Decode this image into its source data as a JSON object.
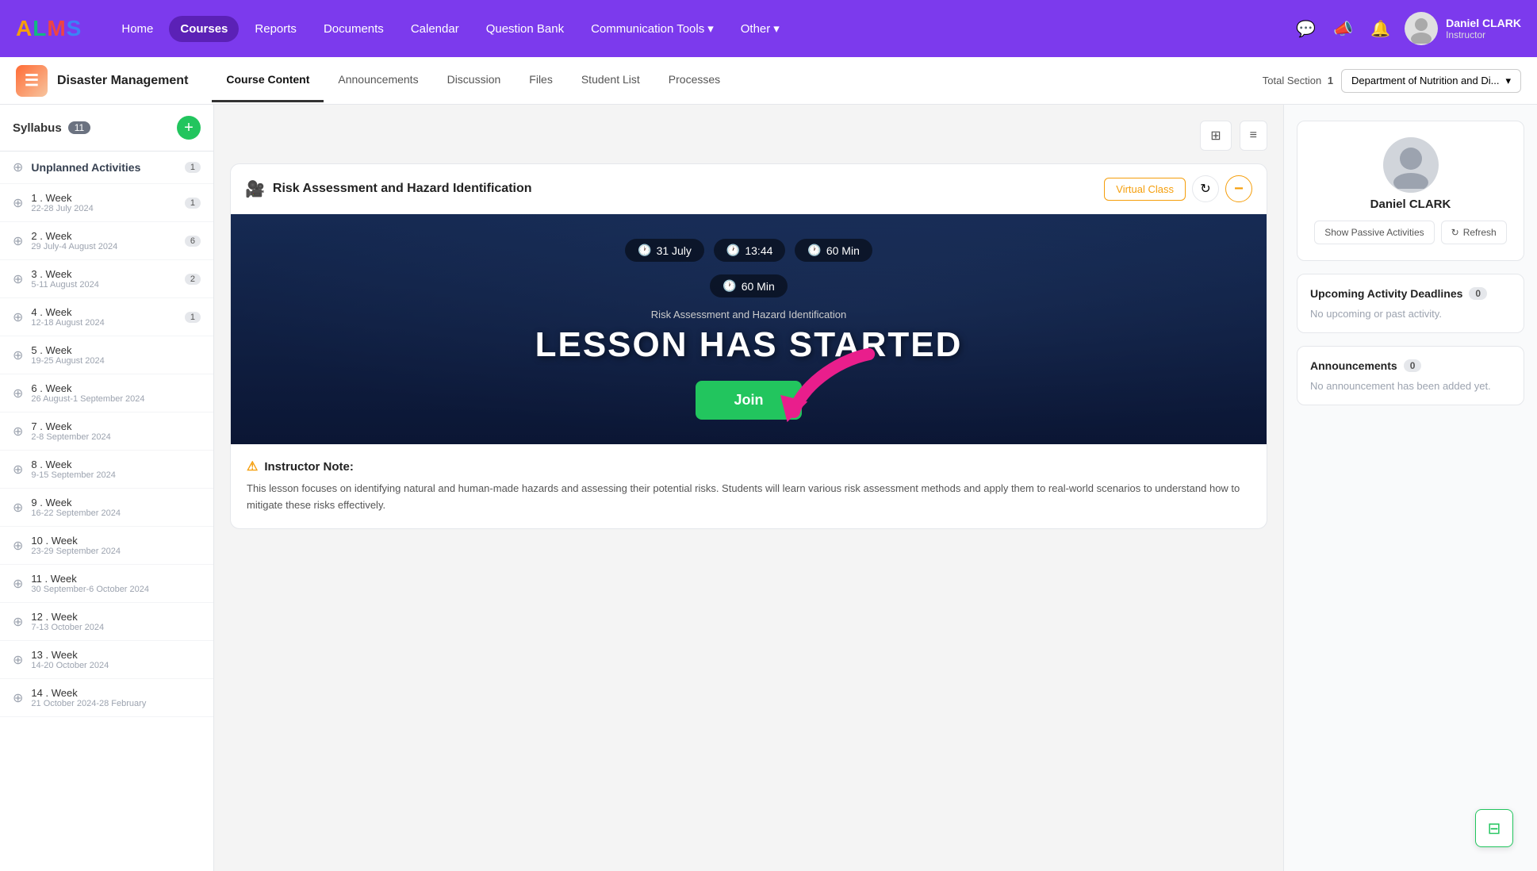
{
  "logo": {
    "a": "A",
    "l": "L",
    "m": "M",
    "s": "S"
  },
  "nav": {
    "links": [
      {
        "label": "Home",
        "active": false
      },
      {
        "label": "Courses",
        "active": true
      },
      {
        "label": "Reports",
        "active": false
      },
      {
        "label": "Documents",
        "active": false
      },
      {
        "label": "Calendar",
        "active": false
      },
      {
        "label": "Question Bank",
        "active": false
      },
      {
        "label": "Communication Tools",
        "active": false,
        "dropdown": true
      },
      {
        "label": "Other",
        "active": false,
        "dropdown": true
      }
    ],
    "user": {
      "name": "Daniel CLARK",
      "role": "Instructor"
    }
  },
  "subnav": {
    "course_title": "Disaster Management",
    "links": [
      {
        "label": "Course Content",
        "active": true
      },
      {
        "label": "Announcements",
        "active": false
      },
      {
        "label": "Discussion",
        "active": false
      },
      {
        "label": "Files",
        "active": false
      },
      {
        "label": "Student List",
        "active": false
      },
      {
        "label": "Processes",
        "active": false
      }
    ],
    "total_section_label": "Total Section",
    "total_section_count": "1",
    "dept_label": "Department of Nutrition and Di..."
  },
  "sidebar": {
    "title": "Syllabus",
    "count": "11",
    "add_btn_label": "+",
    "items": [
      {
        "title": "Unplanned Activities",
        "date": "",
        "count": "1",
        "type": "unplanned"
      },
      {
        "title": "1 . Week",
        "date": "22-28 July 2024",
        "count": "1"
      },
      {
        "title": "2 . Week",
        "date": "29 July-4 August 2024",
        "count": "6"
      },
      {
        "title": "3 . Week",
        "date": "5-11 August 2024",
        "count": "2"
      },
      {
        "title": "4 . Week",
        "date": "12-18 August 2024",
        "count": "1"
      },
      {
        "title": "5 . Week",
        "date": "19-25 August 2024",
        "count": ""
      },
      {
        "title": "6 . Week",
        "date": "26 August-1 September 2024",
        "count": ""
      },
      {
        "title": "7 . Week",
        "date": "2-8 September 2024",
        "count": ""
      },
      {
        "title": "8 . Week",
        "date": "9-15 September 2024",
        "count": ""
      },
      {
        "title": "9 . Week",
        "date": "16-22 September 2024",
        "count": ""
      },
      {
        "title": "10 . Week",
        "date": "23-29 September 2024",
        "count": ""
      },
      {
        "title": "11 . Week",
        "date": "30 September-6 October 2024",
        "count": ""
      },
      {
        "title": "12 . Week",
        "date": "7-13 October 2024",
        "count": ""
      },
      {
        "title": "13 . Week",
        "date": "14-20 October 2024",
        "count": ""
      },
      {
        "title": "14 . Week",
        "date": "21 October 2024-28 February",
        "count": ""
      }
    ]
  },
  "content": {
    "lesson": {
      "title": "Risk Assessment and Hazard Identification",
      "virtual_class_btn": "Virtual Class",
      "banner": {
        "date": "31 July",
        "time": "13:44",
        "duration1": "60 Min",
        "duration2": "60 Min",
        "subtitle": "Risk Assessment and Hazard Identification",
        "started_text": "LESSON HAS STARTED",
        "join_btn": "Join"
      },
      "instructor_note_title": "Instructor Note:",
      "instructor_note_text": "This lesson focuses on identifying natural and human-made hazards and assessing their potential risks. Students will learn various risk assessment methods and apply them to real-world scenarios to understand how to mitigate these risks effectively."
    }
  },
  "right_panel": {
    "instructor": {
      "name": "Daniel CLARK",
      "show_passive_btn": "Show Passive Activities",
      "refresh_btn": "Refresh"
    },
    "upcoming": {
      "title": "Upcoming Activity Deadlines",
      "count": "0",
      "empty_text": "No upcoming or past activity."
    },
    "announcements": {
      "title": "Announcements",
      "count": "0",
      "empty_text": "No announcement has been added yet."
    }
  },
  "fab": {
    "icon": "≡"
  }
}
